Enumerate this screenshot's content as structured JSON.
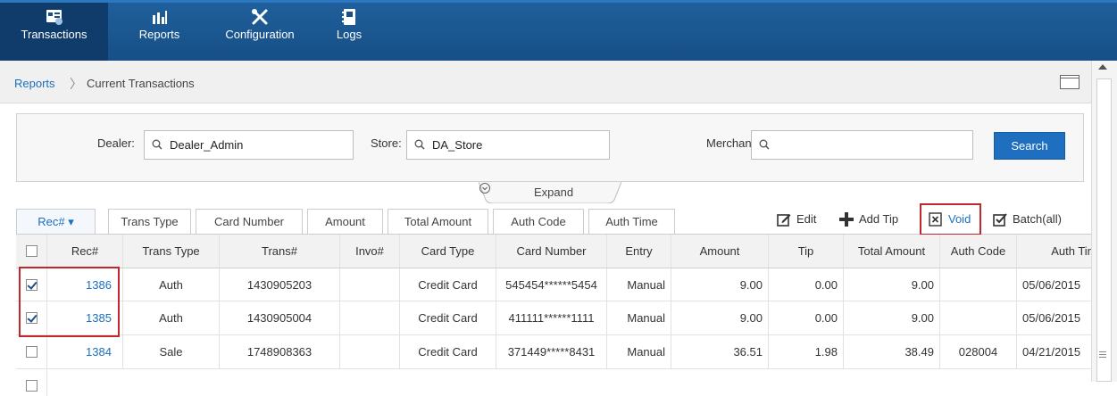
{
  "nav": {
    "items": [
      {
        "label": "Transactions",
        "icon": "transactions-icon",
        "active": true
      },
      {
        "label": "Reports",
        "icon": "reports-icon"
      },
      {
        "label": "Configuration",
        "icon": "tools-icon"
      },
      {
        "label": "Logs",
        "icon": "logs-icon"
      }
    ]
  },
  "breadcrumb": {
    "link": "Reports",
    "separator": "〉",
    "current": "Current Transactions"
  },
  "filters": {
    "dealer_label": "Dealer:",
    "dealer_value": "Dealer_Admin",
    "store_label": "Store:",
    "store_value": "DA_Store",
    "merchant_label": "Merchant:",
    "merchant_value": "",
    "search_label": "Search"
  },
  "expand_label": "Expand",
  "column_tabs": [
    "Rec# ▾",
    "Trans Type",
    "Card Number",
    "Amount",
    "Total Amount",
    "Auth Code",
    "Auth Time"
  ],
  "actions": {
    "edit": "Edit",
    "add_tip": "Add Tip",
    "void": "Void",
    "batch": "Batch(all)"
  },
  "table": {
    "headers": [
      "",
      "Rec#",
      "Trans Type",
      "Trans#",
      "Invo#",
      "Card Type",
      "Card Number",
      "Entry",
      "Amount",
      "Tip",
      "Total Amount",
      "Auth Code",
      "Auth Tir"
    ],
    "rows": [
      {
        "checked": true,
        "cells": [
          "1386",
          "Auth",
          "1430905203",
          "",
          "Credit Card",
          "545454******5454",
          "Manual",
          "9.00",
          "0.00",
          "9.00",
          "",
          "05/06/2015"
        ]
      },
      {
        "checked": true,
        "cells": [
          "1385",
          "Auth",
          "1430905004",
          "",
          "Credit Card",
          "411111******1111",
          "Manual",
          "9.00",
          "0.00",
          "9.00",
          "",
          "05/06/2015"
        ]
      },
      {
        "checked": false,
        "cells": [
          "1384",
          "Sale",
          "1748908363",
          "",
          "Credit Card",
          "371449*****8431",
          "Manual",
          "36.51",
          "1.98",
          "38.49",
          "028004",
          "04/21/2015"
        ]
      },
      {
        "checked": false,
        "cells": [
          "",
          "",
          "",
          "",
          "",
          "",
          "",
          "",
          "",
          "",
          "",
          ""
        ]
      }
    ]
  },
  "colors": {
    "nav_bg": "#174f86",
    "link": "#1a6fbf",
    "highlight": "#c0272d",
    "search_btn": "#1f6fc0"
  }
}
